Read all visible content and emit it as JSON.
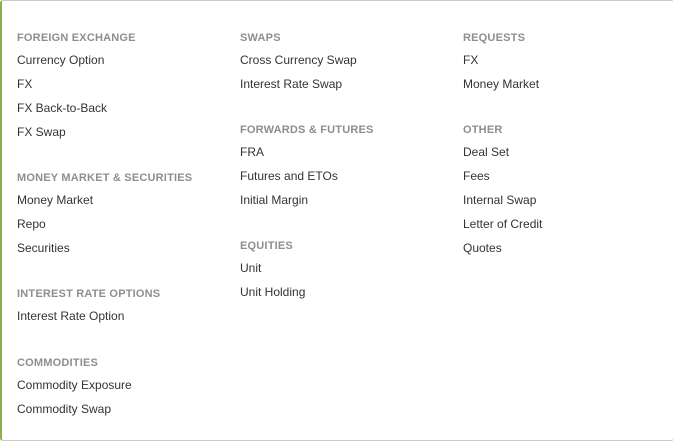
{
  "menu": {
    "foreign_exchange": {
      "heading": "FOREIGN EXCHANGE",
      "items": [
        "Currency Option",
        "FX",
        "FX Back-to-Back",
        "FX Swap"
      ]
    },
    "money_market_securities": {
      "heading": "MONEY MARKET & SECURITIES",
      "items": [
        "Money Market",
        "Repo",
        "Securities"
      ]
    },
    "interest_rate_options": {
      "heading": "INTEREST RATE OPTIONS",
      "items": [
        "Interest Rate Option"
      ]
    },
    "commodities": {
      "heading": "COMMODITIES",
      "items": [
        "Commodity Exposure",
        "Commodity Swap"
      ]
    },
    "swaps": {
      "heading": "SWAPS",
      "items": [
        "Cross Currency Swap",
        "Interest Rate Swap"
      ]
    },
    "forwards_futures": {
      "heading": "FORWARDS & FUTURES",
      "items": [
        "FRA",
        "Futures and ETOs",
        "Initial Margin"
      ]
    },
    "equities": {
      "heading": "EQUITIES",
      "items": [
        "Unit",
        "Unit Holding"
      ]
    },
    "requests": {
      "heading": "REQUESTS",
      "items": [
        "FX",
        "Money Market"
      ]
    },
    "other": {
      "heading": "OTHER",
      "items": [
        "Deal Set",
        "Fees",
        "Internal Swap",
        "Letter of Credit",
        "Quotes"
      ]
    }
  }
}
